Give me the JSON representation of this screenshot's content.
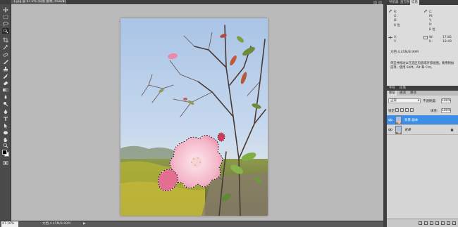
{
  "document": {
    "tab_title": "1.jpg @ 47.2% (背景 副本, RGB/8) *",
    "close_glyph": "×"
  },
  "status": {
    "zoom": "47.16%",
    "doc_info": "文档:4.45M/8.90M",
    "arrow": "▶"
  },
  "info_panel": {
    "tabs": [
      "导航器",
      "直方图",
      "信息"
    ],
    "active_tab": "信息",
    "rows": [
      {
        "a": "R:",
        "b": "C:"
      },
      {
        "a": "G:",
        "b": "M:"
      },
      {
        "a": "B:",
        "b": "Y:"
      },
      {
        "a": "8 位",
        "b": "K:"
      },
      {
        "a": "",
        "b": "8 位"
      }
    ],
    "x_label": "X:",
    "y_label": "Y:",
    "w_label": "W:",
    "h_label": "H:",
    "w_value": "17.85",
    "h_value": "18.49",
    "doc_line": "文档:4.45M/8.90M",
    "hint": "单击并拖动以在选区内容或外部画图。要用附加选项，使用 Shift，Alt 和 Ctrl。"
  },
  "layers_panel": {
    "top_tabs": [
      "字符",
      "段落"
    ],
    "tabs": [
      "图层",
      "通道",
      "路径"
    ],
    "active_tab": "图层",
    "blend_mode": "正常",
    "opacity_label": "不透明度:",
    "opacity_value": "100%",
    "lock_label": "锁定:",
    "fill_label": "填充:",
    "fill_value": "100%",
    "layers": [
      {
        "name": "背景 副本",
        "selected": true
      },
      {
        "name": "背景",
        "selected": false
      }
    ]
  },
  "colors": {
    "accent": "#3d8ee6",
    "canvas_bg": "#bababa",
    "chrome": "#535353"
  },
  "tools": [
    "move-tool-icon",
    "marquee-tool-icon",
    "lasso-tool-icon",
    "quick-select-tool-icon",
    "crop-tool-icon",
    "eyedropper-tool-icon",
    "healing-brush-icon",
    "brush-tool-icon",
    "clone-stamp-icon",
    "history-brush-icon",
    "eraser-tool-icon",
    "gradient-tool-icon",
    "blur-tool-icon",
    "dodge-tool-icon",
    "pen-tool-icon",
    "type-tool-icon",
    "path-select-icon",
    "shape-tool-icon",
    "hand-tool-icon",
    "zoom-tool-icon"
  ]
}
